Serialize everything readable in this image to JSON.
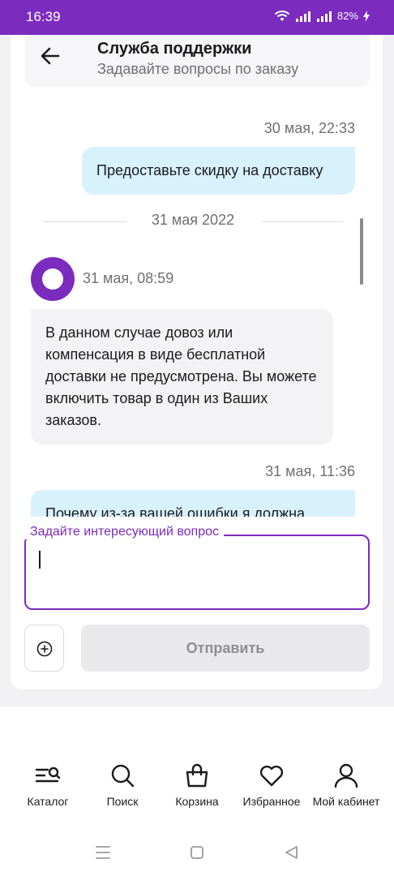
{
  "status_bar": {
    "time": "16:39",
    "battery": "82%"
  },
  "header": {
    "title": "Служба поддержки",
    "subtitle": "Задавайте вопросы по заказу"
  },
  "chat": {
    "messages": [
      {
        "timestamp": "30 мая, 22:33",
        "text": "Предоставьте скидку на доставку"
      },
      {
        "timestamp": "31 мая, 08:59",
        "text": "В данном случае довоз или компенсация в виде бесплатной доставки не предусмотрена. Вы можете включить товар в один из Ваших заказов."
      },
      {
        "timestamp": "31 мая, 11:36",
        "text": "Почему из-за вашей ошибки я должна"
      }
    ],
    "date_separator": "31 мая 2022"
  },
  "composer": {
    "label": "Задайте интересующий вопрос",
    "value": "",
    "send_label": "Отправить"
  },
  "bottom_nav": [
    {
      "label": "Каталог",
      "icon": "catalog-search-icon"
    },
    {
      "label": "Поиск",
      "icon": "search-icon"
    },
    {
      "label": "Корзина",
      "icon": "shopping-bag-icon"
    },
    {
      "label": "Избранное",
      "icon": "heart-icon"
    },
    {
      "label": "Мой кабинет",
      "icon": "user-icon"
    }
  ],
  "colors": {
    "brand": "#7b2bbe",
    "outgoing_bubble": "#d8f2fd",
    "incoming_bubble": "#f3f3f5"
  }
}
